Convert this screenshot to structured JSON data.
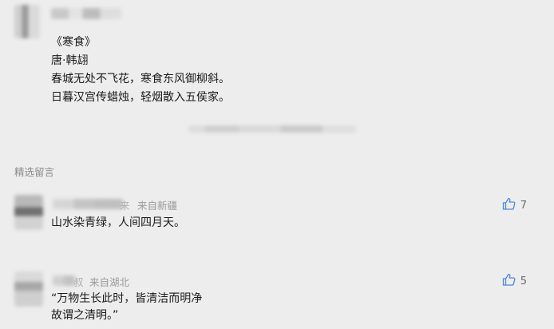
{
  "poem": {
    "title": "《寒食》",
    "author": "唐·韩翃",
    "line1": "春城无处不飞花，寒食东风御柳斜。",
    "line2": "日暮汉宫传蜡烛，轻烟散入五侯家。"
  },
  "comments_section": {
    "title": "精选留言"
  },
  "comments": [
    {
      "name_fragment": "来",
      "origin": "来自新疆",
      "lines": [
        "山水染青绿，人间四月天。"
      ],
      "likes": "7"
    },
    {
      "name_fragment": "叔",
      "origin": "来自湖北",
      "lines": [
        "“万物生长此时，皆清洁而明净",
        "故谓之清明。”"
      ],
      "likes": "5"
    }
  ],
  "icons": {
    "like": "thumbs-up-icon"
  },
  "colors": {
    "background": "#ededed",
    "text": "#1a1a1a",
    "muted": "#8a8a8a"
  }
}
